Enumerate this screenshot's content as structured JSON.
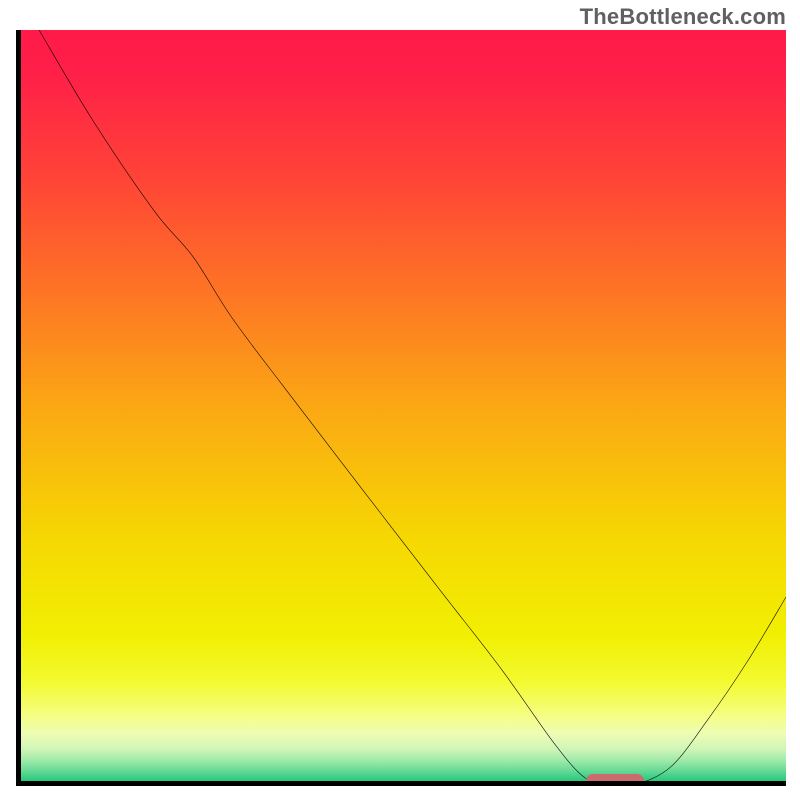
{
  "watermark": "TheBottleneck.com",
  "colors": {
    "gradient_stops": [
      {
        "offset": 0.0,
        "color": "#ff1a49"
      },
      {
        "offset": 0.06,
        "color": "#ff2048"
      },
      {
        "offset": 0.19,
        "color": "#ff4237"
      },
      {
        "offset": 0.33,
        "color": "#fe6f27"
      },
      {
        "offset": 0.5,
        "color": "#fba813"
      },
      {
        "offset": 0.67,
        "color": "#f6d703"
      },
      {
        "offset": 0.8,
        "color": "#f1ef02"
      },
      {
        "offset": 0.862,
        "color": "#f3fa2f"
      },
      {
        "offset": 0.905,
        "color": "#f5fe80"
      },
      {
        "offset": 0.93,
        "color": "#eefdb2"
      },
      {
        "offset": 0.95,
        "color": "#d2f6b8"
      },
      {
        "offset": 0.965,
        "color": "#a4ebab"
      },
      {
        "offset": 0.978,
        "color": "#6edc98"
      },
      {
        "offset": 0.99,
        "color": "#35cd82"
      },
      {
        "offset": 1.0,
        "color": "#0bc26f"
      }
    ],
    "curve": "#000000",
    "axis": "#000000",
    "marker": "#cd6a6d",
    "watermark_text": "#606060"
  },
  "chart_data": {
    "type": "line",
    "title": "",
    "xlabel": "",
    "ylabel": "",
    "xlim": [
      0,
      100
    ],
    "ylim": [
      0,
      100
    ],
    "x": [
      3,
      10,
      18,
      23,
      28,
      35,
      45,
      55,
      63,
      70,
      74,
      77.5,
      80,
      85,
      90,
      95,
      100
    ],
    "values": [
      100,
      88,
      76,
      70,
      62,
      52.5,
      39.2,
      26.0,
      15.5,
      5.5,
      1.0,
      0.0,
      0.0,
      2.5,
      9.0,
      16.5,
      25.0
    ],
    "marker": {
      "x_start": 74.0,
      "x_end": 81.5,
      "y": 0.0
    },
    "annotations": [
      {
        "text": "TheBottleneck.com",
        "position": "top-right"
      }
    ],
    "grid": false,
    "legend": false
  }
}
